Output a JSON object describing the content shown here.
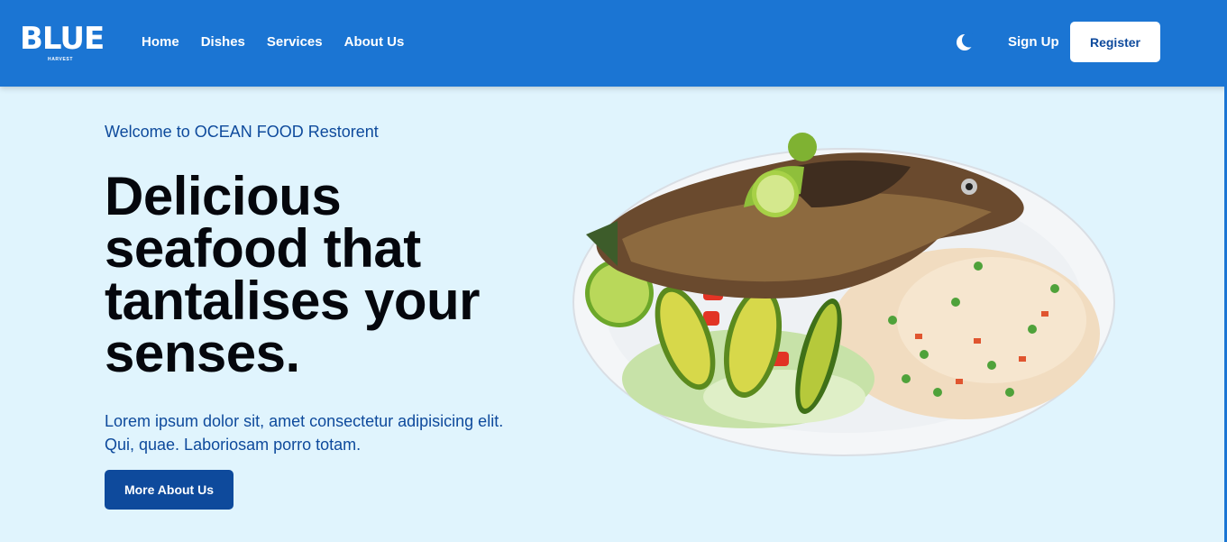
{
  "brand": {
    "logo_text": "BLUE",
    "logo_sub": "HARVEST"
  },
  "nav": {
    "links": [
      "Home",
      "Dishes",
      "Services",
      "About Us"
    ],
    "theme_icon": "moon-icon",
    "signup_label": "Sign Up",
    "register_label": "Register"
  },
  "hero": {
    "welcome": "Welcome to OCEAN FOOD Restorent",
    "headline": "Delicious seafood that tantalises your senses.",
    "lead": "Lorem ipsum dolor sit, amet consectetur adipisicing elit. Qui, quae. Laboriosam porro totam.",
    "cta_label": "More About Us",
    "image": "fried-fish-plate-image"
  },
  "colors": {
    "navbar": "#1b75d3",
    "page_background": "#e0f4fd",
    "primary_dark": "#0e4a9c",
    "headline": "#05070d"
  }
}
